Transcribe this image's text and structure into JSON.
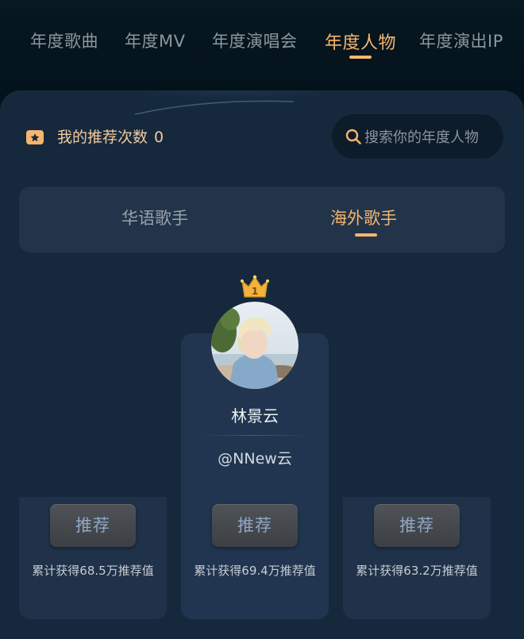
{
  "top_tabs": [
    {
      "label": "年度歌曲"
    },
    {
      "label": "年度MV"
    },
    {
      "label": "年度演唱会"
    },
    {
      "label": "年度人物"
    },
    {
      "label": "年度演出IP"
    }
  ],
  "active_top_tab": "年度人物",
  "recommend": {
    "label": "我的推荐次数",
    "count": "0"
  },
  "search": {
    "placeholder": "搜索你的年度人物"
  },
  "sub_tabs": [
    {
      "label": "华语歌手"
    },
    {
      "label": "海外歌手"
    }
  ],
  "active_sub_tab": "海外歌手",
  "featured": {
    "rank": "1",
    "name": "林景云",
    "handle": "@NNew云"
  },
  "cards": [
    {
      "button_label": "推荐",
      "accumulated": "累计获得68.5万推荐值"
    },
    {
      "button_label": "推荐",
      "accumulated": "累计获得69.4万推荐值"
    },
    {
      "button_label": "推荐",
      "accumulated": "累计获得63.2万推荐值"
    }
  ],
  "colors": {
    "accent": "#f5b56f",
    "panel": "#16293c",
    "card": "#1f3249",
    "button_text": "#8fa6c6"
  }
}
